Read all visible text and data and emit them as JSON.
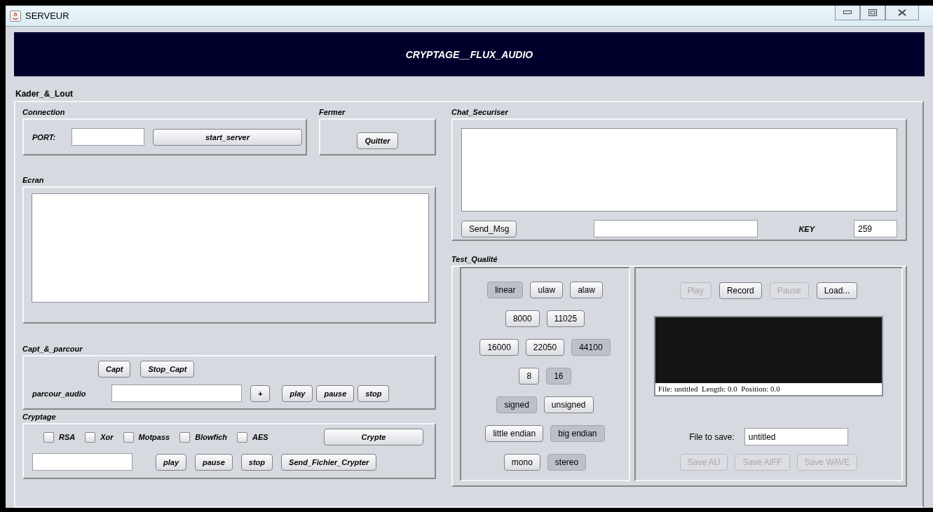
{
  "window": {
    "title": "SERVEUR"
  },
  "banner": {
    "title": "CRYPTAGE__FLUX_AUDIO"
  },
  "panel_title": "Kader_&_Lout",
  "connection": {
    "title": "Connection",
    "port_label": "PORT:",
    "button": "start_server"
  },
  "fermer": {
    "title": "Fermer",
    "button": "Quitter"
  },
  "ecran": {
    "title": "Ecran"
  },
  "capture": {
    "title": "Capt_&_parcour",
    "buttons": [
      "Capt",
      "Stop_Capt"
    ],
    "path_label": "parcour_audio",
    "player_buttons": [
      "+",
      "play",
      "pause",
      "stop"
    ]
  },
  "cryptage": {
    "title": "Cryptage",
    "algorithms": [
      {
        "label": "RSA",
        "checked": false
      },
      {
        "label": "Xor",
        "checked": false
      },
      {
        "label": "Motpass",
        "checked": false
      },
      {
        "label": "Blowfich",
        "checked": false
      },
      {
        "label": "AES",
        "checked": false
      }
    ],
    "button": "Crypte",
    "player_buttons": [
      "play",
      "pause",
      "stop",
      "Send_Fichier_Crypter"
    ]
  },
  "chat": {
    "title": "Chat_Securiser",
    "send_button": "Send_Msg",
    "key_label": "KEY",
    "key_value": "259"
  },
  "test": {
    "title": "Test_Qualité",
    "format_rows": [
      [
        {
          "label": "linear",
          "selected": true
        },
        {
          "label": "ulaw",
          "selected": false
        },
        {
          "label": "alaw",
          "selected": false
        }
      ],
      [
        {
          "label": "8000",
          "selected": false
        },
        {
          "label": "11025",
          "selected": false
        }
      ],
      [
        {
          "label": "16000",
          "selected": false
        },
        {
          "label": "22050",
          "selected": false
        },
        {
          "label": "44100",
          "selected": true
        }
      ],
      [
        {
          "label": "8",
          "selected": false
        },
        {
          "label": "16",
          "selected": true
        }
      ],
      [
        {
          "label": "signed",
          "selected": true
        },
        {
          "label": "unsigned",
          "selected": false
        }
      ],
      [
        {
          "label": "little endian",
          "selected": false
        },
        {
          "label": "big endian",
          "selected": true
        }
      ],
      [
        {
          "label": "mono",
          "selected": false
        },
        {
          "label": "stereo",
          "selected": true
        }
      ]
    ],
    "transport": [
      {
        "label": "Play",
        "disabled": true
      },
      {
        "label": "Record",
        "disabled": false
      },
      {
        "label": "Pause",
        "disabled": true
      },
      {
        "label": "Load...",
        "disabled": false
      }
    ],
    "status": "File: untitled  Length: 0.0  Position: 0.0",
    "file_label": "File to save:",
    "file_value": "untitled",
    "save_buttons": [
      {
        "label": "Save AU",
        "disabled": true
      },
      {
        "label": "Save AIFF",
        "disabled": true
      },
      {
        "label": "Save WAVE",
        "disabled": true
      }
    ]
  }
}
